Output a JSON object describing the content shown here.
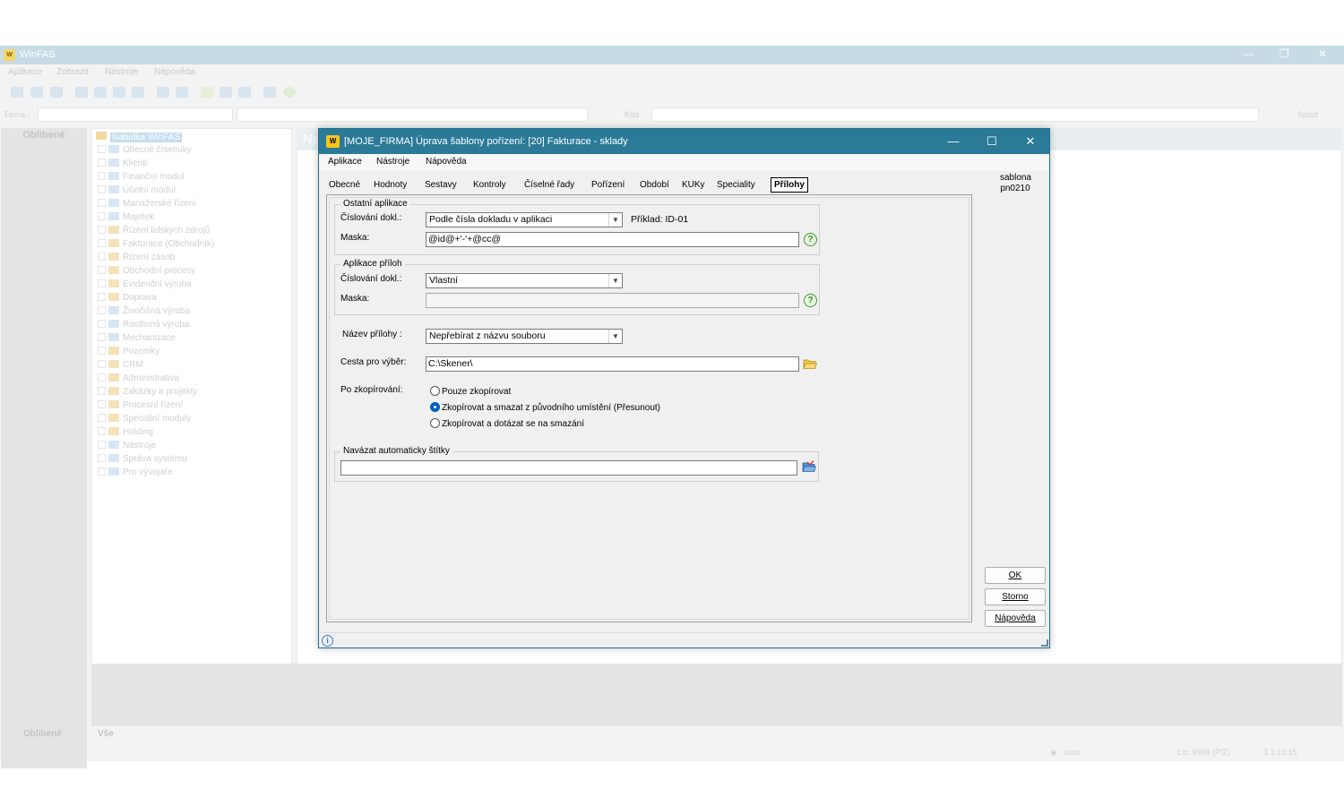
{
  "bg_app": {
    "title": "WinFAS",
    "logo": "W",
    "menu": [
      "Aplikace",
      "Zobrazit",
      "Nástroje",
      "Nápověda"
    ],
    "filter": {
      "firma_label": "Firma :",
      "kod_label": "Kód :",
      "run_label": "Spusť"
    },
    "favorites_header": "Oblíbené",
    "tree_root": "Nabídka WinFAS",
    "tree_items": [
      "Obecné číselníky",
      "Klienti",
      "Finanční modul",
      "Účetní modul",
      "Manažerské řízení",
      "Majetek",
      "Řízení lidských zdrojů",
      "Fakturace (Obchodník)",
      "Řízení zásob",
      "Obchodní procesy",
      "Evidenční výroba",
      "Doprava",
      "Živočišná výroba",
      "Rostlinná výroba",
      "Mechanizace",
      "Pozemky",
      "CRM",
      "Administrativa",
      "Zakázky a projekty",
      "Procesní řízení",
      "Speciální moduly",
      "Holding",
      "Nástroje",
      "Správa systému",
      "Pro vývojáře"
    ],
    "right_header": "Na",
    "bottom_tabs": [
      "Oblíbené",
      "Vše"
    ],
    "status": {
      "user": "host",
      "lic": "Lic: 9999  (P/Z)",
      "version": "3.3.10.15"
    }
  },
  "dialog": {
    "logo": "W",
    "title": "[MOJE_FIRMA] Úprava šablony pořízení: [20] Fakturace - sklady",
    "controls": {
      "minimize": "—",
      "maximize": "☐",
      "close": "✕"
    },
    "menu": [
      "Aplikace",
      "Nástroje",
      "Nápověda"
    ],
    "tabs": [
      "Obecné",
      "Hodnoty",
      "Sestavy",
      "Kontroly",
      "Číselné řady",
      "Pořízení",
      "Období",
      "KUKy",
      "Speciality",
      "Přílohy"
    ],
    "active_tab": "Přílohy",
    "side_text": [
      "sablona",
      "pn0210"
    ],
    "group_ostatni": {
      "title": "Ostatní aplikace",
      "cislovani_label": "Číslování dokl.:",
      "cislovani_value": "Podle čísla dokladu v aplikaci",
      "priklad": "Příklad: ID-01",
      "maska_label": "Maska:",
      "maska_value": "@id@+'-'+@cc@"
    },
    "group_prilohy": {
      "title": "Aplikace příloh",
      "cislovani_label": "Číslování dokl.:",
      "cislovani_value": "Vlastní",
      "maska_label": "Maska:",
      "maska_value": ""
    },
    "nazev_label": "Název přílohy :",
    "nazev_value": "Nepřebírat z názvu souboru",
    "cesta_label": "Cesta pro výběr:",
    "cesta_value": "C:\\Skener\\",
    "po_label": "Po zkopírování:",
    "radio_options": [
      "Pouze zkopírovat",
      "Zkopírovat a smazat z původního umístění (Přesunout)",
      "Zkopírovat a  dotázat se na smazání"
    ],
    "radio_selected": 1,
    "stitky_title": "Navázat automaticky štítky",
    "stitky_value": "",
    "buttons": {
      "ok": "OK",
      "storno": "Storno",
      "napoveda": "Nápověda"
    },
    "help_glyph": "?",
    "info_glyph": "i",
    "colors": {
      "titlebar": "#2a7a98",
      "accent": "#005fb8",
      "help": "#3b9b30"
    }
  }
}
